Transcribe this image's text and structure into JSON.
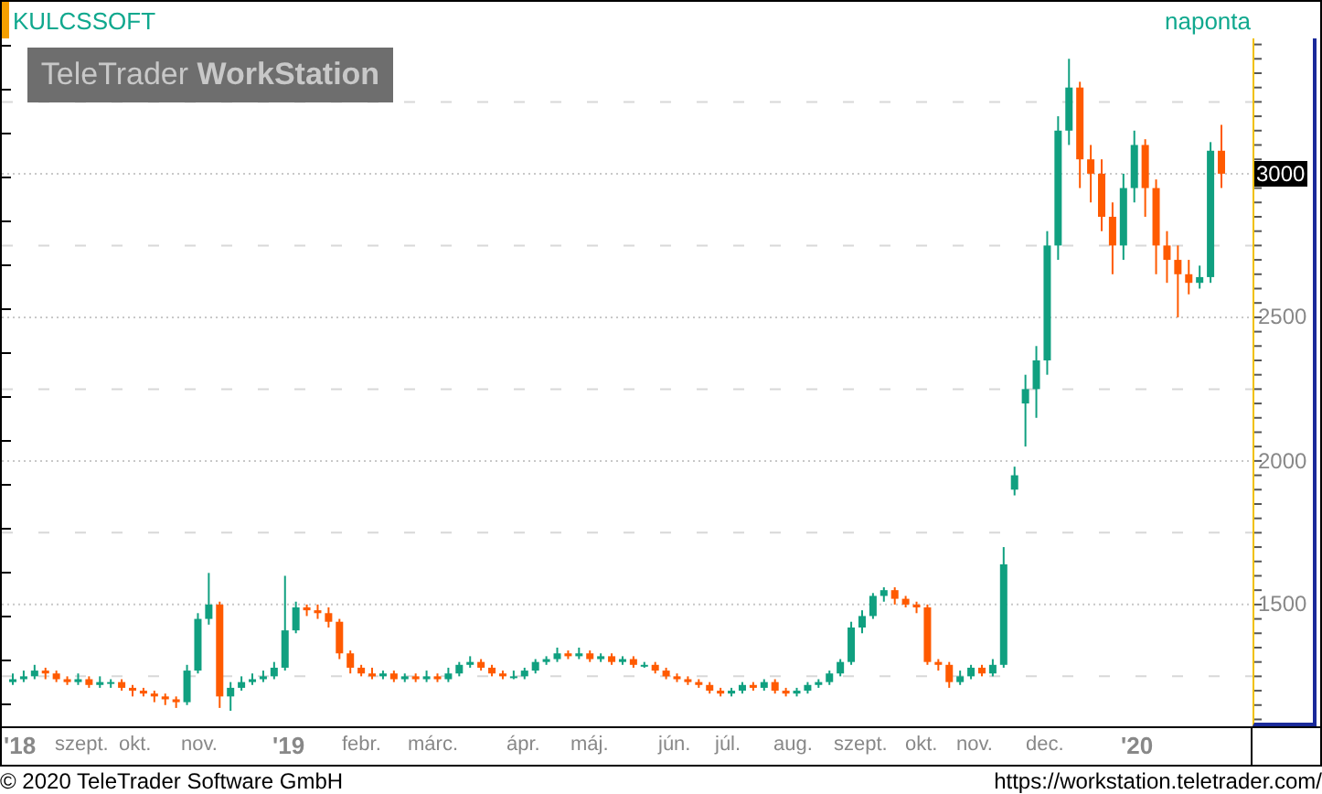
{
  "header": {
    "symbol": "KULCSSOFT",
    "interval": "naponta"
  },
  "logo": "TeleTrader **WorkStation**",
  "chart_data": {
    "type": "candlestick",
    "ylim": [
      1076,
      3471
    ],
    "yticks": [
      2500,
      2000,
      1500
    ],
    "annotations": [
      "3000"
    ],
    "grid": true,
    "ohlc": [
      [
        1230,
        1260,
        1220,
        1240
      ],
      [
        1240,
        1270,
        1230,
        1250
      ],
      [
        1250,
        1290,
        1240,
        1270
      ],
      [
        1270,
        1280,
        1240,
        1260
      ],
      [
        1260,
        1270,
        1230,
        1240
      ],
      [
        1240,
        1250,
        1220,
        1230
      ],
      [
        1230,
        1260,
        1220,
        1240
      ],
      [
        1240,
        1250,
        1210,
        1220
      ],
      [
        1220,
        1250,
        1210,
        1230
      ],
      [
        1230,
        1240,
        1210,
        1230
      ],
      [
        1230,
        1240,
        1200,
        1210
      ],
      [
        1210,
        1220,
        1180,
        1200
      ],
      [
        1200,
        1210,
        1180,
        1190
      ],
      [
        1190,
        1200,
        1160,
        1180
      ],
      [
        1180,
        1190,
        1150,
        1170
      ],
      [
        1170,
        1180,
        1140,
        1160
      ],
      [
        1160,
        1290,
        1150,
        1270
      ],
      [
        1270,
        1470,
        1260,
        1450
      ],
      [
        1450,
        1610,
        1430,
        1500
      ],
      [
        1500,
        1510,
        1140,
        1180
      ],
      [
        1180,
        1230,
        1130,
        1210
      ],
      [
        1210,
        1250,
        1200,
        1230
      ],
      [
        1230,
        1260,
        1220,
        1240
      ],
      [
        1240,
        1270,
        1230,
        1250
      ],
      [
        1250,
        1300,
        1240,
        1280
      ],
      [
        1280,
        1600,
        1270,
        1410
      ],
      [
        1410,
        1510,
        1400,
        1490
      ],
      [
        1490,
        1500,
        1460,
        1480
      ],
      [
        1480,
        1500,
        1450,
        1470
      ],
      [
        1470,
        1490,
        1420,
        1440
      ],
      [
        1440,
        1450,
        1310,
        1330
      ],
      [
        1330,
        1340,
        1260,
        1280
      ],
      [
        1280,
        1290,
        1250,
        1260
      ],
      [
        1260,
        1280,
        1240,
        1250
      ],
      [
        1250,
        1270,
        1240,
        1260
      ],
      [
        1260,
        1270,
        1230,
        1240
      ],
      [
        1240,
        1260,
        1230,
        1250
      ],
      [
        1250,
        1260,
        1230,
        1240
      ],
      [
        1240,
        1270,
        1230,
        1250
      ],
      [
        1250,
        1260,
        1230,
        1240
      ],
      [
        1240,
        1280,
        1230,
        1260
      ],
      [
        1260,
        1300,
        1250,
        1290
      ],
      [
        1290,
        1320,
        1280,
        1300
      ],
      [
        1300,
        1310,
        1270,
        1280
      ],
      [
        1280,
        1290,
        1250,
        1260
      ],
      [
        1260,
        1270,
        1240,
        1250
      ],
      [
        1250,
        1270,
        1240,
        1250
      ],
      [
        1250,
        1280,
        1240,
        1270
      ],
      [
        1270,
        1310,
        1260,
        1300
      ],
      [
        1300,
        1320,
        1290,
        1310
      ],
      [
        1310,
        1350,
        1300,
        1330
      ],
      [
        1330,
        1340,
        1310,
        1320
      ],
      [
        1320,
        1350,
        1310,
        1330
      ],
      [
        1330,
        1340,
        1300,
        1310
      ],
      [
        1310,
        1330,
        1300,
        1320
      ],
      [
        1320,
        1330,
        1290,
        1300
      ],
      [
        1300,
        1320,
        1290,
        1310
      ],
      [
        1310,
        1320,
        1280,
        1290
      ],
      [
        1290,
        1300,
        1280,
        1290
      ],
      [
        1290,
        1300,
        1260,
        1270
      ],
      [
        1270,
        1280,
        1240,
        1250
      ],
      [
        1250,
        1260,
        1230,
        1240
      ],
      [
        1240,
        1250,
        1220,
        1230
      ],
      [
        1230,
        1240,
        1210,
        1220
      ],
      [
        1220,
        1230,
        1190,
        1200
      ],
      [
        1200,
        1210,
        1180,
        1190
      ],
      [
        1190,
        1210,
        1180,
        1200
      ],
      [
        1200,
        1230,
        1190,
        1220
      ],
      [
        1220,
        1230,
        1200,
        1210
      ],
      [
        1210,
        1240,
        1200,
        1230
      ],
      [
        1230,
        1240,
        1190,
        1200
      ],
      [
        1200,
        1210,
        1180,
        1190
      ],
      [
        1190,
        1210,
        1180,
        1200
      ],
      [
        1200,
        1230,
        1190,
        1220
      ],
      [
        1220,
        1240,
        1210,
        1230
      ],
      [
        1230,
        1270,
        1220,
        1260
      ],
      [
        1260,
        1310,
        1250,
        1300
      ],
      [
        1300,
        1440,
        1290,
        1420
      ],
      [
        1420,
        1480,
        1400,
        1460
      ],
      [
        1460,
        1540,
        1450,
        1530
      ],
      [
        1530,
        1560,
        1510,
        1550
      ],
      [
        1550,
        1560,
        1500,
        1520
      ],
      [
        1520,
        1530,
        1490,
        1500
      ],
      [
        1500,
        1510,
        1470,
        1490
      ],
      [
        1490,
        1500,
        1290,
        1300
      ],
      [
        1300,
        1310,
        1270,
        1290
      ],
      [
        1290,
        1300,
        1210,
        1230
      ],
      [
        1230,
        1270,
        1220,
        1250
      ],
      [
        1250,
        1290,
        1240,
        1280
      ],
      [
        1280,
        1290,
        1250,
        1260
      ],
      [
        1260,
        1310,
        1250,
        1290
      ],
      [
        1290,
        1700,
        1280,
        1640
      ],
      [
        1900,
        1980,
        1880,
        1950
      ],
      [
        2200,
        2300,
        2050,
        2250
      ],
      [
        2250,
        2400,
        2150,
        2350
      ],
      [
        2350,
        2800,
        2300,
        2750
      ],
      [
        2750,
        3200,
        2700,
        3150
      ],
      [
        3150,
        3400,
        3100,
        3300
      ],
      [
        3300,
        3320,
        2950,
        3050
      ],
      [
        3050,
        3100,
        2900,
        3000
      ],
      [
        3000,
        3050,
        2800,
        2850
      ],
      [
        2850,
        2900,
        2650,
        2750
      ],
      [
        2750,
        3000,
        2700,
        2950
      ],
      [
        2950,
        3150,
        2900,
        3100
      ],
      [
        3100,
        3120,
        2850,
        2950
      ],
      [
        2950,
        2980,
        2650,
        2750
      ],
      [
        2750,
        2800,
        2620,
        2700
      ],
      [
        2700,
        2750,
        2500,
        2650
      ],
      [
        2650,
        2700,
        2580,
        2620
      ],
      [
        2620,
        2680,
        2600,
        2640
      ],
      [
        2640,
        3110,
        2620,
        3080
      ],
      [
        3080,
        3170,
        2950,
        3000
      ]
    ]
  },
  "date_axis": [
    {
      "text": "'18",
      "kind": "year"
    },
    {
      "text": "szept.",
      "kind": "month"
    },
    {
      "text": "okt.",
      "kind": "month"
    },
    {
      "text": "nov.",
      "kind": "month"
    },
    {
      "text": "'19",
      "kind": "year"
    },
    {
      "text": "febr.",
      "kind": "month"
    },
    {
      "text": "márc.",
      "kind": "month"
    },
    {
      "text": "ápr.",
      "kind": "month"
    },
    {
      "text": "máj.",
      "kind": "month"
    },
    {
      "text": "jún.",
      "kind": "month"
    },
    {
      "text": "júl.",
      "kind": "month"
    },
    {
      "text": "aug.",
      "kind": "month"
    },
    {
      "text": "szept.",
      "kind": "month"
    },
    {
      "text": "okt.",
      "kind": "month"
    },
    {
      "text": "nov.",
      "kind": "month"
    },
    {
      "text": "dec.",
      "kind": "month"
    },
    {
      "text": "'20",
      "kind": "year"
    }
  ],
  "footer": {
    "copyright": "© 2020 TeleTrader Software GmbH",
    "url": "https://workstation.teletrader.com/"
  }
}
